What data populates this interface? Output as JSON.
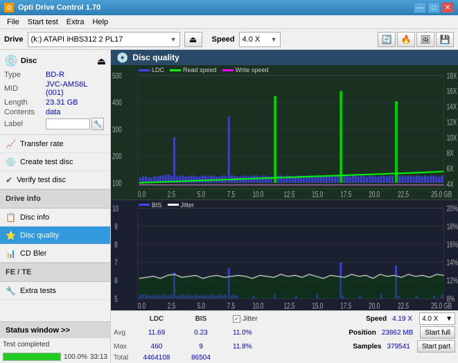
{
  "titlebar": {
    "title": "Opti Drive Control 1.70",
    "minimize": "—",
    "maximize": "□",
    "close": "✕"
  },
  "menubar": {
    "items": [
      "File",
      "Start test",
      "Extra",
      "Help"
    ]
  },
  "toolbar": {
    "drive_label": "Drive",
    "drive_value": "(k:) ATAPI iHBS312  2 PL17",
    "speed_label": "Speed",
    "speed_value": "4.0 X"
  },
  "disc": {
    "title": "Disc",
    "type_label": "Type",
    "type_value": "BD-R",
    "mid_label": "MID",
    "mid_value": "JVC-AMS6L (001)",
    "length_label": "Length",
    "length_value": "23.31 GB",
    "contents_label": "Contents",
    "contents_value": "data",
    "label_label": "Label",
    "label_value": ""
  },
  "nav": {
    "items": [
      {
        "label": "Transfer rate",
        "icon": "📈"
      },
      {
        "label": "Create test disc",
        "icon": "💿"
      },
      {
        "label": "Verify test disc",
        "icon": "✔"
      },
      {
        "label": "Drive info",
        "icon": "ℹ"
      },
      {
        "label": "Disc info",
        "icon": "📋"
      },
      {
        "label": "Disc quality",
        "icon": "⭐",
        "active": true
      },
      {
        "label": "CD Bler",
        "icon": "📊"
      },
      {
        "label": "FE / TE",
        "icon": "📉"
      },
      {
        "label": "Extra tests",
        "icon": "🔧"
      }
    ]
  },
  "status_window": {
    "label": "Status window >>",
    "progress": 100,
    "progress_text": "100.0%",
    "time": "33:13",
    "status": "Test completed"
  },
  "disc_quality": {
    "title": "Disc quality",
    "legend_upper": [
      {
        "label": "LDC",
        "color": "#0000ff"
      },
      {
        "label": "Read speed",
        "color": "#00ff00"
      },
      {
        "label": "Write speed",
        "color": "#ff00ff"
      }
    ],
    "legend_lower": [
      {
        "label": "BIS",
        "color": "#0000ff"
      },
      {
        "label": "Jitter",
        "color": "#ffffff"
      }
    ],
    "upper_ymax": 500,
    "upper_ymax2": 18,
    "lower_ymax": 10,
    "lower_ymax2": 20,
    "xmax": 25.0,
    "stats": {
      "ldc_label": "LDC",
      "bis_label": "BIS",
      "jitter_label": "Jitter",
      "jitter_checked": true,
      "avg_label": "Avg",
      "max_label": "Max",
      "total_label": "Total",
      "ldc_avg": "11.69",
      "ldc_max": "460",
      "ldc_total": "4464108",
      "bis_avg": "0.23",
      "bis_max": "9",
      "bis_total": "86504",
      "jitter_avg": "11.0%",
      "jitter_max": "11.8%",
      "speed_label": "Speed",
      "speed_value": "4.19 X",
      "speed_target": "4.0 X",
      "position_label": "Position",
      "position_value": "23862 MB",
      "samples_label": "Samples",
      "samples_value": "379541",
      "start_full": "Start full",
      "start_part": "Start part"
    }
  }
}
